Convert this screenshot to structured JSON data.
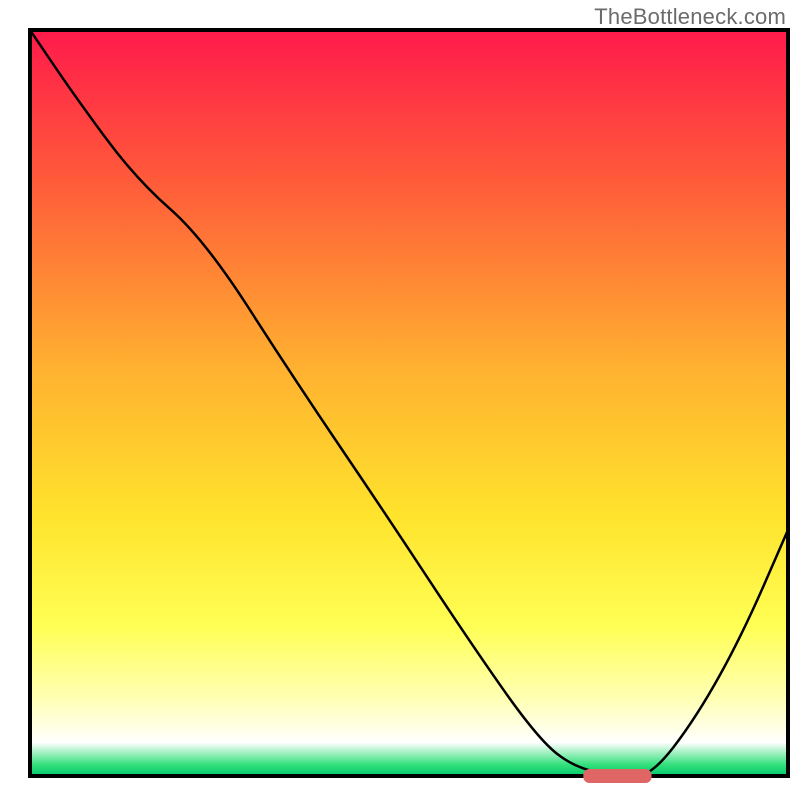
{
  "watermark": "TheBottleneck.com",
  "chart_data": {
    "type": "line",
    "title": "",
    "xlabel": "",
    "ylabel": "",
    "xlim": [
      0,
      100
    ],
    "ylim": [
      0,
      100
    ],
    "gradient_stops": [
      {
        "offset": 0.0,
        "color": "#ff1a4b"
      },
      {
        "offset": 0.2,
        "color": "#ff5a3a"
      },
      {
        "offset": 0.45,
        "color": "#ffb030"
      },
      {
        "offset": 0.65,
        "color": "#ffe32c"
      },
      {
        "offset": 0.8,
        "color": "#ffff55"
      },
      {
        "offset": 0.9,
        "color": "#ffffb8"
      },
      {
        "offset": 0.955,
        "color": "#ffffff"
      },
      {
        "offset": 0.985,
        "color": "#33e07a"
      },
      {
        "offset": 1.0,
        "color": "#00c96b"
      }
    ],
    "series": [
      {
        "name": "curve",
        "x": [
          0,
          6,
          14,
          23,
          35,
          47,
          58,
          67,
          72,
          78,
          82,
          88,
          94,
          100
        ],
        "y": [
          100,
          91,
          80,
          72,
          53,
          35,
          18,
          5,
          1,
          0,
          0,
          8,
          19,
          33
        ]
      }
    ],
    "marker": {
      "x_start": 73,
      "x_end": 82,
      "y": 0,
      "color": "#e06666"
    },
    "frame_color": "#000000",
    "curve_color": "#000000",
    "curve_width": 2.5
  }
}
